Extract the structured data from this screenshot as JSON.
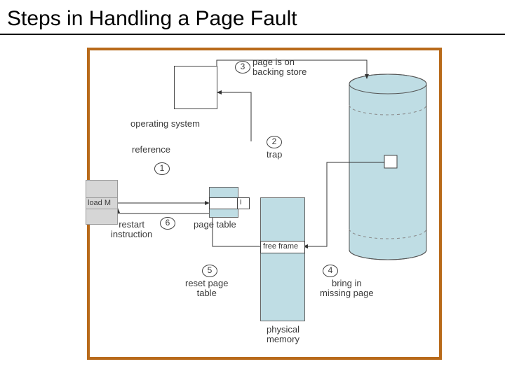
{
  "title": "Steps in Handling a Page Fault",
  "steps": {
    "1": "1",
    "2": "2",
    "3": "3",
    "4": "4",
    "5": "5",
    "6": "6"
  },
  "labels": {
    "page_backing": "page is on\nbacking store",
    "os": "operating\nsystem",
    "reference": "reference",
    "trap": "trap",
    "load_m": "load M",
    "i": "i",
    "restart": "restart\ninstruction",
    "page_table": "page table",
    "free_frame": "free frame",
    "reset_pt": "reset page\ntable",
    "bring_in": "bring in\nmissing page",
    "phys_mem": "physical\nmemory"
  }
}
